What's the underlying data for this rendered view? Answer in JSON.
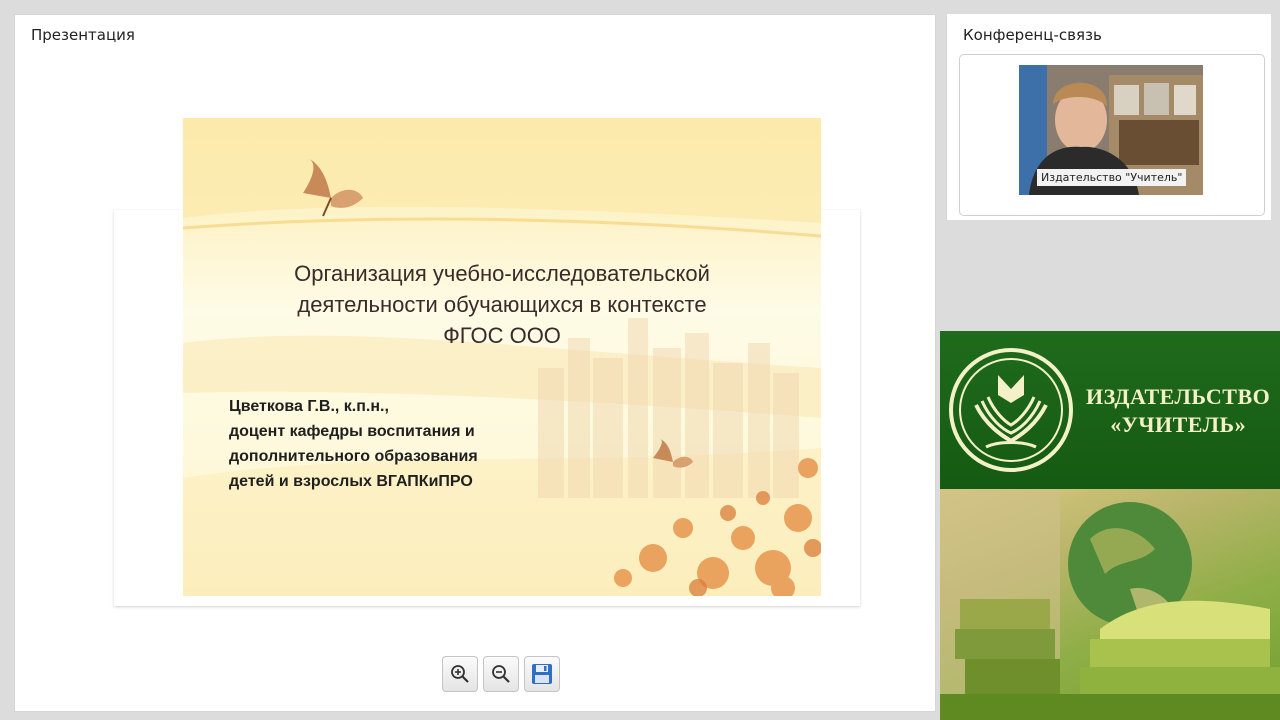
{
  "presentation": {
    "title": "Презентация",
    "slide": {
      "title_lines": [
        "Организация учебно-исследовательской",
        "деятельности обучающихся в контексте",
        "ФГОС ООО"
      ],
      "author_lines": [
        "Цветкова Г.В., к.п.н.,",
        "доцент кафедры воспитания и",
        "дополнительного образования",
        "детей и взрослых ВГАПКиПРО"
      ]
    },
    "toolbar": {
      "zoom_in_icon": "zoom-in-icon",
      "zoom_out_icon": "zoom-out-icon",
      "save_icon": "floppy-disk-icon"
    }
  },
  "conference": {
    "title": "Конференц-связь",
    "participant_caption": "Издательство \"Учитель\""
  },
  "banner": {
    "line1": "ИЗДАТЕЛЬСТВО",
    "line2": "«УЧИТЕЛЬ»",
    "colors": {
      "green": "#1f6b1c",
      "cream": "#f4f0c8"
    }
  }
}
